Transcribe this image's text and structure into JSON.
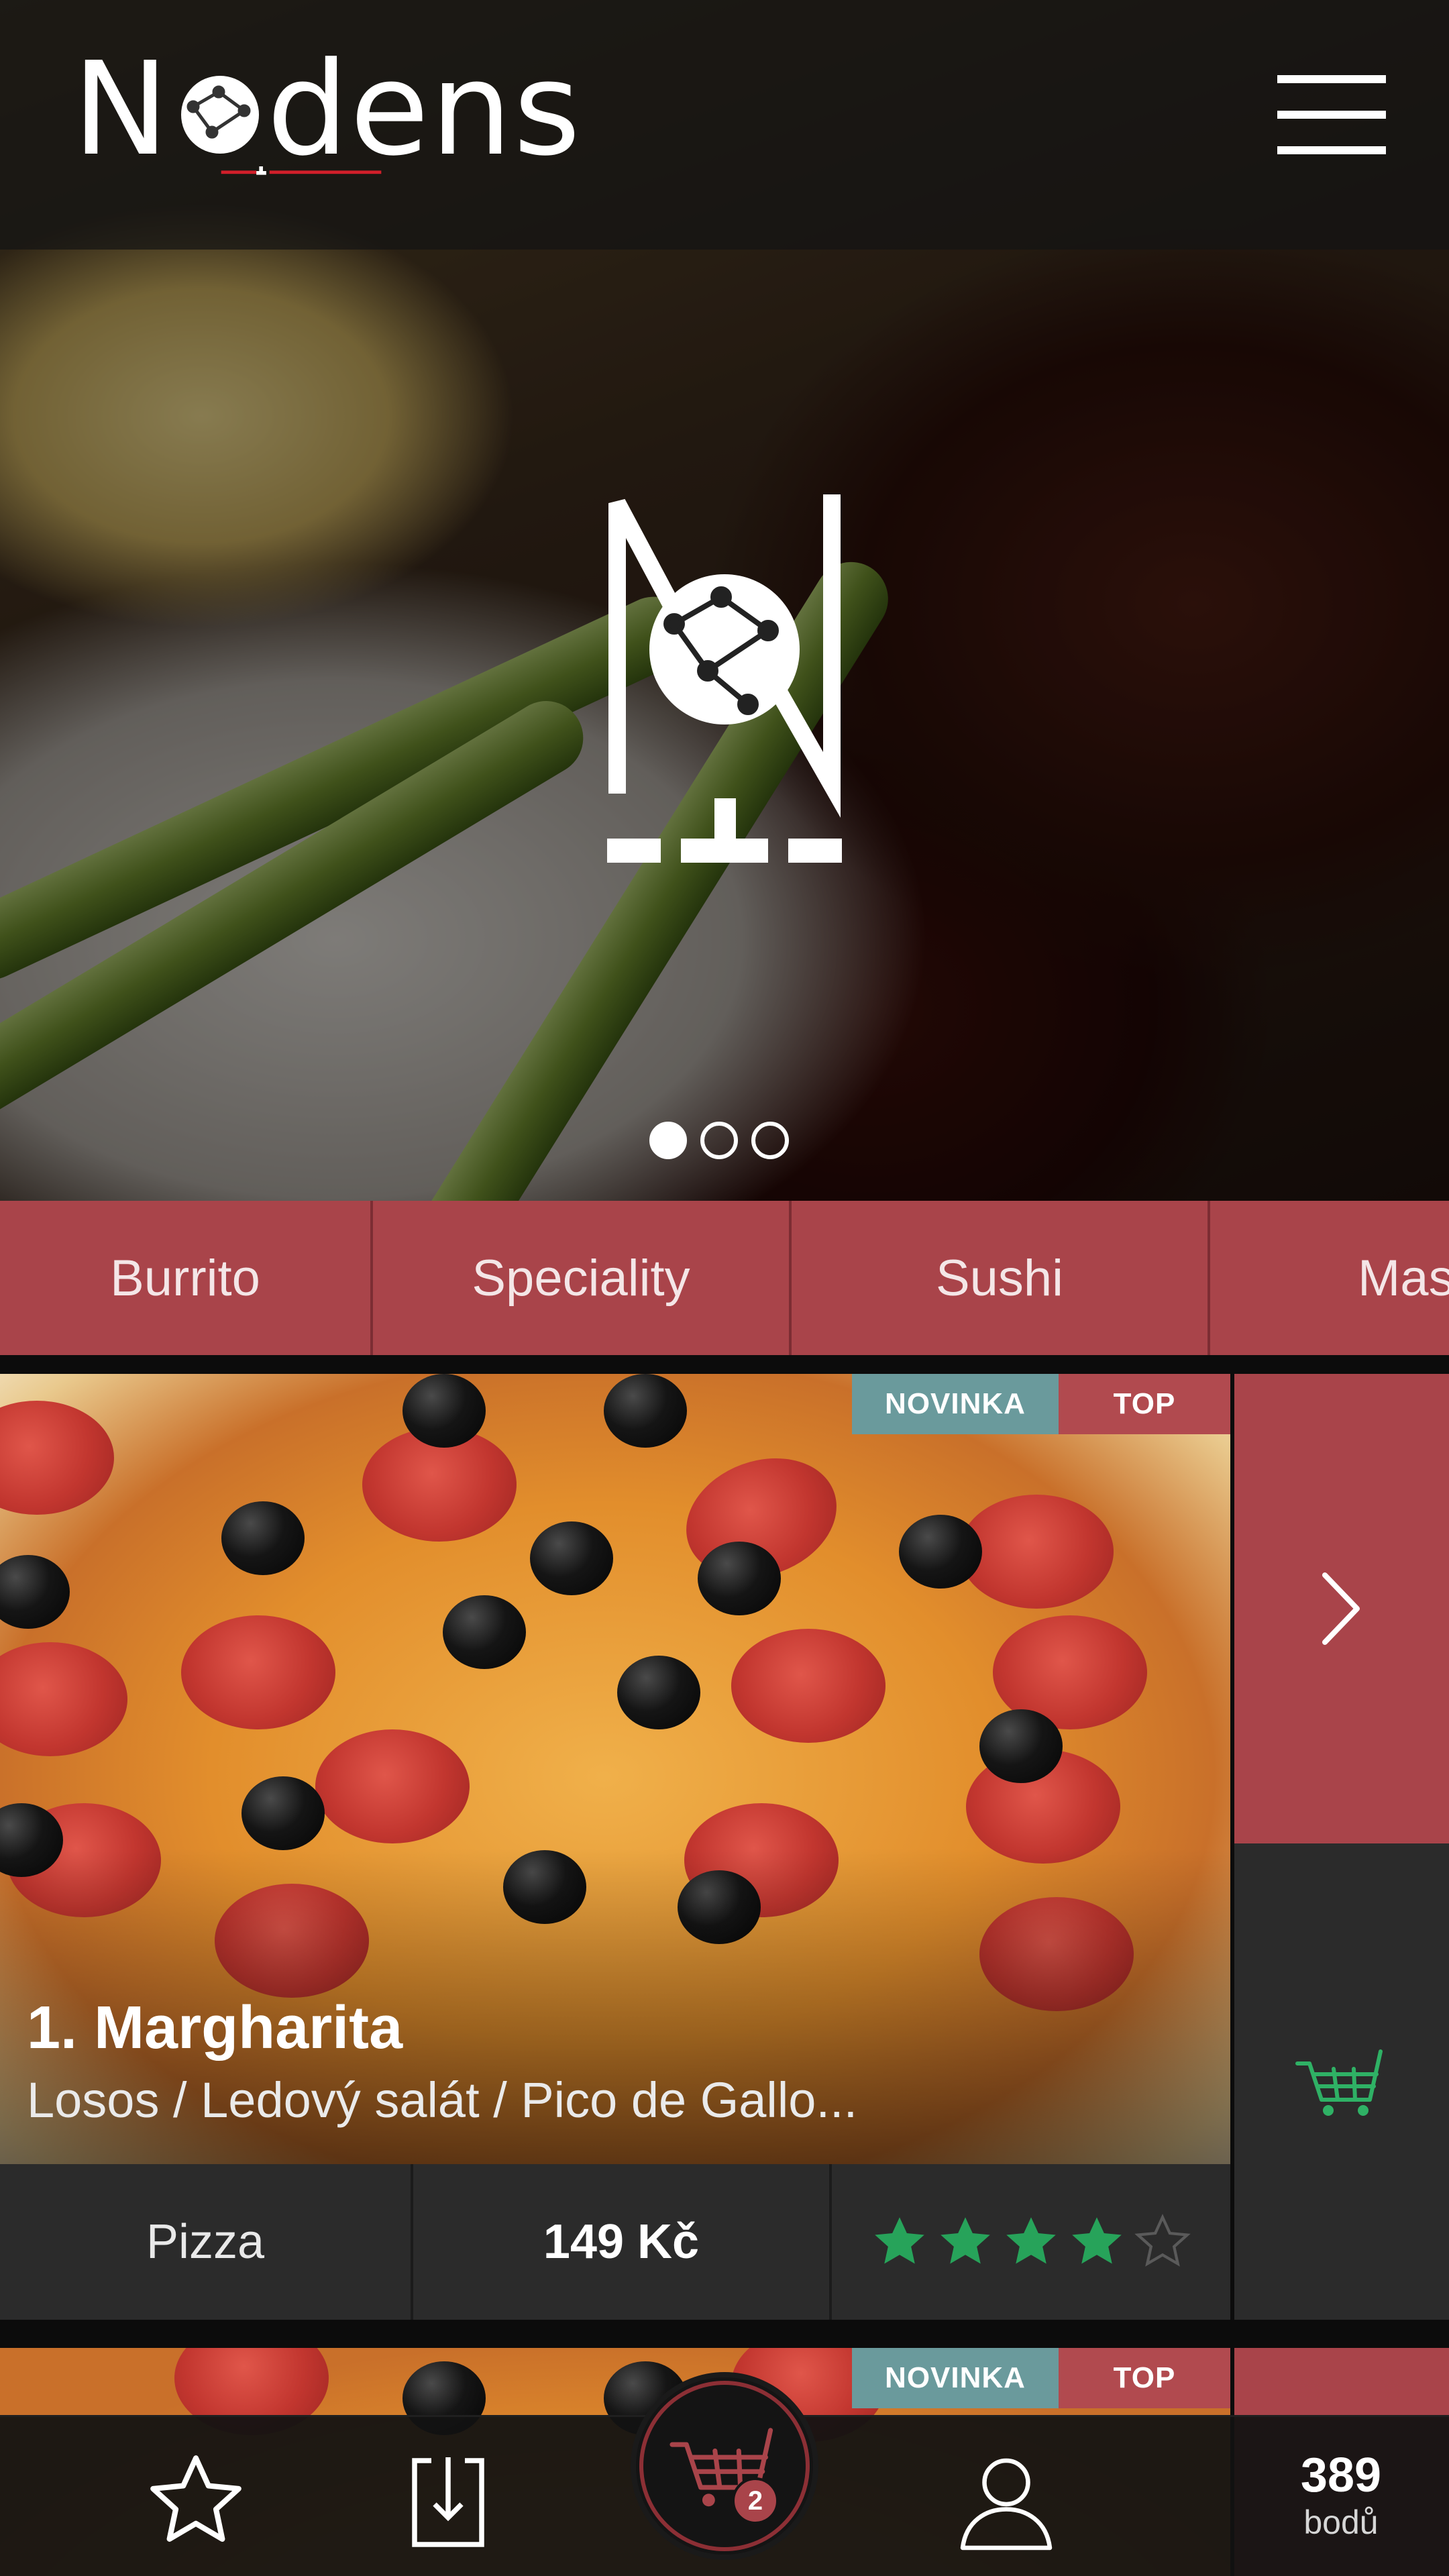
{
  "header": {
    "brand": "Nodens",
    "brand_prefix": "N",
    "brand_suffix": "dens",
    "menu_icon": "hamburger-menu-icon"
  },
  "hero": {
    "logo_icon": "nodens-logo-icon",
    "slides_total": 3,
    "slide_active": 1
  },
  "categories": [
    {
      "label": "Burrito"
    },
    {
      "label": "Speciality"
    },
    {
      "label": "Sushi"
    },
    {
      "label": "Mas"
    }
  ],
  "product": {
    "badge_new": "NOVINKA",
    "badge_top": "TOP",
    "name": "1. Margharita",
    "description": "Losos / Ledový salát / Pico de Gallo...",
    "category": "Pizza",
    "price": "149 Kč",
    "rating": 4,
    "rating_max": 5,
    "next_icon": "chevron-right-icon",
    "cart_icon": "cart-icon"
  },
  "next_product": {
    "badge_new": "NOVINKA",
    "badge_top": "TOP"
  },
  "bottom_nav": {
    "favorites_icon": "star-icon",
    "download_icon": "download-icon",
    "cart_icon": "cart-icon",
    "cart_count": "2",
    "profile_icon": "user-icon",
    "points_value": "389",
    "points_label": "bodů"
  },
  "colors": {
    "accent": "#a9444a",
    "badge_new": "#6a9a9c",
    "star": "#27a35a",
    "dark": "#2b2b2b"
  }
}
